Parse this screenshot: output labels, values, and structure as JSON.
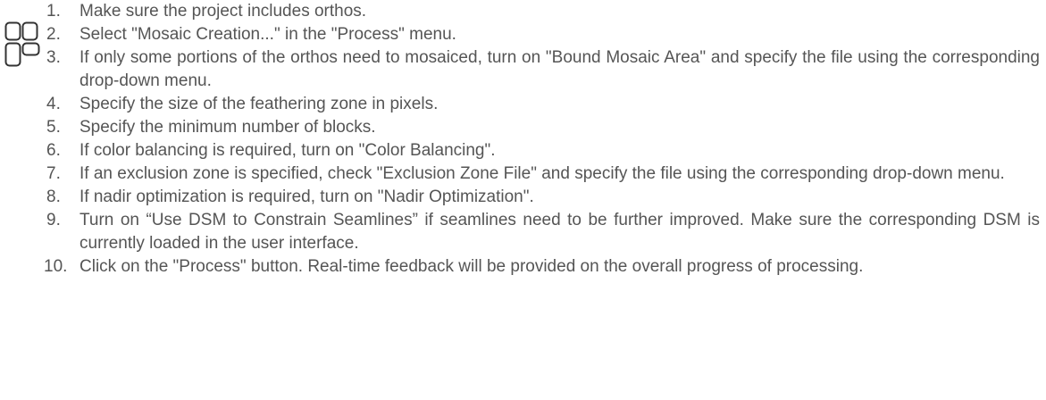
{
  "icon": "steps-icon",
  "steps": [
    {
      "num": "1.",
      "text": "Make sure the project includes orthos."
    },
    {
      "num": "2.",
      "text": "Select \"Mosaic Creation...\" in the \"Process\" menu."
    },
    {
      "num": "3.",
      "text": "If only some portions of the orthos need to mosaiced, turn on \"Bound Mosaic Area\" and specify the file using the corresponding drop-down menu."
    },
    {
      "num": "4.",
      "text": "Specify the size of the feathering zone in pixels."
    },
    {
      "num": "5.",
      "text": "Specify the minimum number of blocks."
    },
    {
      "num": "6.",
      "text": "If color balancing is required, turn on \"Color Balancing\"."
    },
    {
      "num": "7.",
      "text": "If an exclusion zone is specified, check \"Exclusion Zone File\" and specify the file using the corresponding drop-down menu."
    },
    {
      "num": "8.",
      "text": "If nadir optimization is required, turn on \"Nadir Optimization\"."
    },
    {
      "num": "9.",
      "text": "Turn on “Use DSM to Constrain Seamlines” if seamlines need to be further improved. Make sure the corresponding DSM is currently loaded in the user interface."
    },
    {
      "num": "10.",
      "text": "Click on the \"Process\" button.  Real-time feedback will be provided on the overall progress of processing."
    }
  ]
}
